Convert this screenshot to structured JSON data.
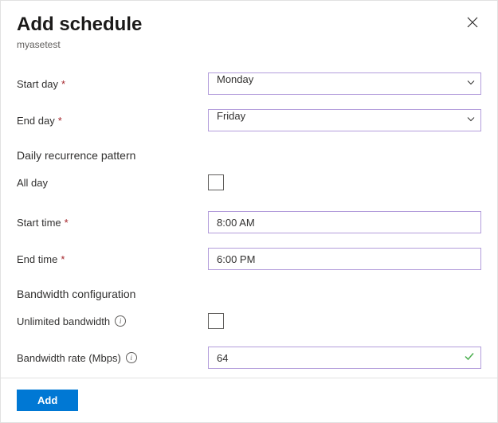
{
  "header": {
    "title": "Add schedule",
    "subtitle": "myasetest"
  },
  "fields": {
    "start_day": {
      "label": "Start day",
      "value": "Monday",
      "required": true
    },
    "end_day": {
      "label": "End day",
      "value": "Friday",
      "required": true
    },
    "recurrence_heading": "Daily recurrence pattern",
    "all_day": {
      "label": "All day",
      "checked": false
    },
    "start_time": {
      "label": "Start time",
      "value": "8:00 AM",
      "required": true
    },
    "end_time": {
      "label": "End time",
      "value": "6:00 PM",
      "required": true
    },
    "bandwidth_heading": "Bandwidth configuration",
    "unlimited": {
      "label": "Unlimited bandwidth",
      "checked": false
    },
    "rate": {
      "label": "Bandwidth rate (Mbps)",
      "value": "64"
    }
  },
  "footer": {
    "add_label": "Add"
  }
}
